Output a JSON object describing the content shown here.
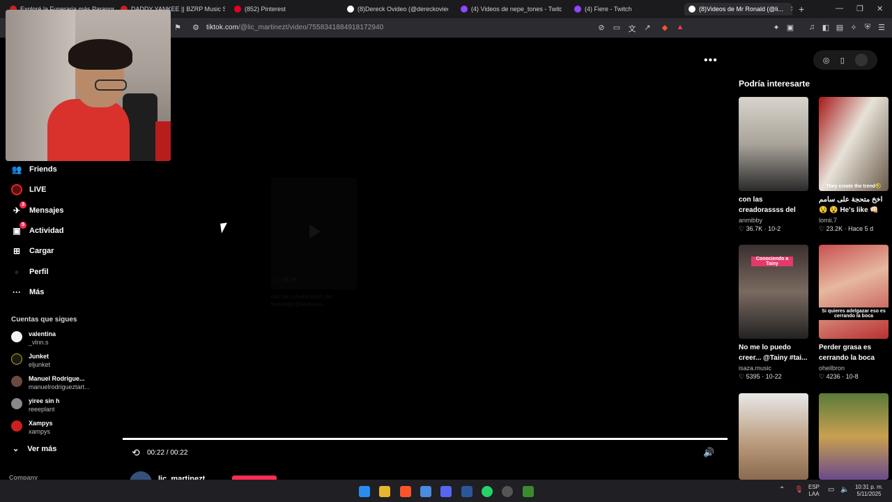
{
  "browser": {
    "tabs": [
      {
        "label": "Exploré la Funeraria más Paranorma...",
        "color": "#cc2020"
      },
      {
        "label": "DADDY YANKEE || BZRP Music Sessi...",
        "color": "#cc2020"
      },
      {
        "label": "(852) Pinterest",
        "color": "#e60023"
      },
      {
        "label": "(8)Dereck Ovideo (@dereckoviedo20...",
        "color": "#ffffff"
      },
      {
        "label": "(4) Videos de nepe_tones - Twitch",
        "color": "#9146ff"
      },
      {
        "label": "(4) Fiere - Twitch",
        "color": "#9146ff"
      },
      {
        "label": "(8)Videos de Mr Ronald (@li...",
        "color": "#ffffff"
      }
    ],
    "new_tab": "+",
    "window_controls": [
      "—",
      "❐",
      "✕"
    ],
    "url_host": "tiktok.com",
    "url_path": "/@lic_martinezt/video/7558341884918172940"
  },
  "nav": {
    "items": [
      {
        "label": "Friends",
        "icon": "friends-icon",
        "glyph": "👥"
      },
      {
        "label": "LIVE",
        "icon": "live-icon",
        "glyph": ""
      },
      {
        "label": "Mensajes",
        "icon": "messages-icon",
        "glyph": "✈",
        "badge": "3"
      },
      {
        "label": "Actividad",
        "icon": "activity-icon",
        "glyph": "▣",
        "badge": "5"
      },
      {
        "label": "Cargar",
        "icon": "upload-icon",
        "glyph": "⊞"
      },
      {
        "label": "Perfil",
        "icon": "profile-icon",
        "glyph": "●"
      },
      {
        "label": "Más",
        "icon": "more-icon",
        "glyph": "···"
      }
    ],
    "following_title": "Cuentas que sigues",
    "following": [
      {
        "name": "valentina",
        "handle": "_vlnn.s",
        "color": "#f2f2f2"
      },
      {
        "name": "Junket",
        "handle": "eljunket",
        "color": "#1a1a1a"
      },
      {
        "name": "Manuel Rodrigue...",
        "handle": "manuelrodrigueztart...",
        "color": "#6a4a40"
      },
      {
        "name": "yiree sin h",
        "handle": "reeeplant",
        "color": "#888888"
      },
      {
        "name": "Xampys",
        "handle": "xampys",
        "color": "#cc2020"
      }
    ],
    "see_more": "Ver más",
    "company": "Company"
  },
  "video": {
    "more": "•••",
    "time": "00:22 / 00:22",
    "progress": 1.0,
    "ghost_views": "▷ 36.7K",
    "ghost_caption": "con las creadorassss del trendddd @fiesta ba...",
    "author": "lic_martinezt"
  },
  "recommend": {
    "title": "Podría interesarte",
    "cards": [
      {
        "caption": "con las creadorassss del trendddd @fies...",
        "user": "anmibby",
        "likes": "36.7K",
        "date": "10-2",
        "thumb": "party",
        "overlay": ""
      },
      {
        "caption": "اخخ متحجة على سامم 😵 😵 He's like 👊🏻 👍🏻 ...",
        "user": "lomii.7",
        "likes": "23.2K",
        "date": "Hace 5 d",
        "thumb": "movie",
        "overlay": "They create the trend🤣"
      },
      {
        "caption": "No me lo puedo creer... @Tainy #tai...",
        "user": "isaza.music",
        "likes": "5395",
        "date": "10-22",
        "thumb": "group",
        "overlay": "Conociendo a Tainy"
      },
      {
        "caption": "Perder grasa es cerrando la boca",
        "user": "oheilbron",
        "likes": "4236",
        "date": "10-8",
        "thumb": "face",
        "overlay": "Si quieres adelgazar eso es cerrando la boca"
      },
      {
        "caption": "",
        "user": "",
        "likes": "",
        "date": "",
        "thumb": "dog",
        "overlay": ""
      },
      {
        "caption": "",
        "user": "",
        "likes": "",
        "date": "",
        "thumb": "game",
        "overlay": ""
      }
    ]
  },
  "taskbar": {
    "lang_1": "ESP",
    "lang_2": "LAA",
    "time": "10:31 p. m.",
    "date": "5/11/2025"
  }
}
